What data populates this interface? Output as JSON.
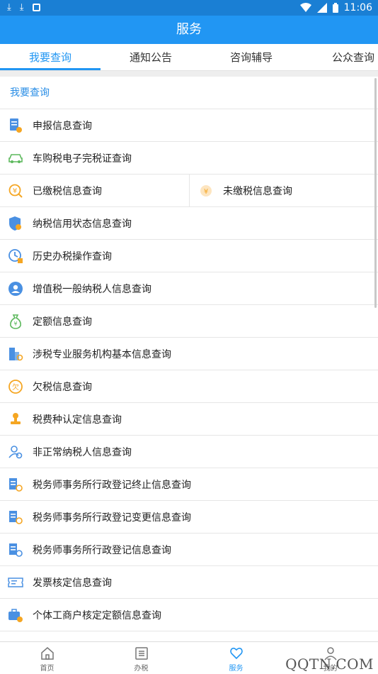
{
  "status_bar": {
    "time": "11:06",
    "left_icons": [
      "download-icon",
      "download-icon",
      "image-icon"
    ],
    "right_icons": [
      "wifi-icon",
      "signal-icon",
      "battery-icon"
    ]
  },
  "app_bar": {
    "title": "服务"
  },
  "tabs": [
    {
      "label": "我要查询",
      "active": true
    },
    {
      "label": "通知公告",
      "active": false
    },
    {
      "label": "咨询辅导",
      "active": false
    },
    {
      "label": "公众查询",
      "active": false
    }
  ],
  "section": {
    "title": "我要查询"
  },
  "items": [
    {
      "label": "申报信息查询",
      "icon": "declare-doc-icon"
    },
    {
      "label": "车购税电子完税证查询",
      "icon": "car-icon"
    },
    {
      "label": "已缴税信息查询",
      "icon": "paid-tax-icon"
    },
    {
      "label": "未缴税信息查询",
      "icon": "unpaid-tax-icon"
    },
    {
      "label": "纳税信用状态信息查询",
      "icon": "credit-shield-icon"
    },
    {
      "label": "历史办税操作查询",
      "icon": "history-clock-icon"
    },
    {
      "label": "增值税一般纳税人信息查询",
      "icon": "vat-user-icon"
    },
    {
      "label": "定额信息查询",
      "icon": "quota-bag-icon"
    },
    {
      "label": "涉税专业服务机构基本信息查询",
      "icon": "building-search-icon"
    },
    {
      "label": "欠税信息查询",
      "icon": "owed-tax-icon"
    },
    {
      "label": "税费种认定信息查询",
      "icon": "stamp-icon"
    },
    {
      "label": "非正常纳税人信息查询",
      "icon": "abnormal-user-icon"
    },
    {
      "label": "税务师事务所行政登记终止信息查询",
      "icon": "office-doc-icon"
    },
    {
      "label": "税务师事务所行政登记变更信息查询",
      "icon": "office-doc-icon"
    },
    {
      "label": "税务师事务所行政登记信息查询",
      "icon": "office-doc-icon"
    },
    {
      "label": "发票核定信息查询",
      "icon": "invoice-ticket-icon"
    },
    {
      "label": "个体工商户核定定额信息查询",
      "icon": "business-owner-icon"
    }
  ],
  "bottom_nav": [
    {
      "label": "首页",
      "icon": "home-icon",
      "active": false
    },
    {
      "label": "办税",
      "icon": "list-icon",
      "active": false
    },
    {
      "label": "服务",
      "icon": "heart-icon",
      "active": true
    },
    {
      "label": "我的",
      "icon": "user-icon",
      "active": false
    }
  ],
  "watermark": "QQTN.COM",
  "colors": {
    "primary": "#2196f3",
    "status_bar": "#1a7fd4",
    "section_title": "#2a8ee6",
    "icon_blue": "#4a90e2",
    "icon_orange": "#f5a623",
    "icon_green": "#5cb85c"
  }
}
